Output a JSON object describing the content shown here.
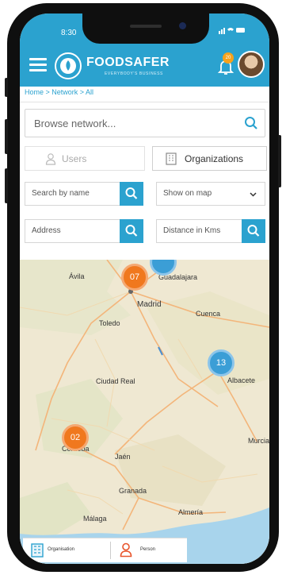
{
  "status": {
    "time": "8:30",
    "icons": "..ıl ≈ ▬"
  },
  "header": {
    "app_name": "FOODSAFER",
    "tagline": "EVERYBODY'S BUSINESS",
    "notification_count": "20",
    "brand_color": "#2ba2cf"
  },
  "breadcrumb": "Home > Network > All",
  "search": {
    "placeholder": "Browse network..."
  },
  "tabs": {
    "users": "Users",
    "organizations": "Organizations"
  },
  "filters": {
    "search_by_name": "Search by name",
    "show_on_map": "Show on map",
    "address": "Address",
    "distance": "Distance in Kms"
  },
  "map": {
    "places": [
      "Ávila",
      "Guadalajara",
      "Madrid",
      "Toledo",
      "Cuenca",
      "Ciudad Real",
      "Albacete",
      "Murcia",
      "Córdoba",
      "Jaén",
      "Granada",
      "Almería",
      "Málaga"
    ],
    "clusters": [
      {
        "label": "07",
        "color": "#f0781e"
      },
      {
        "label": "13",
        "color": "#3b9ed6"
      },
      {
        "label": "02",
        "color": "#f0781e"
      }
    ]
  },
  "legend": {
    "organisation": "Organisation",
    "person": "Person"
  }
}
